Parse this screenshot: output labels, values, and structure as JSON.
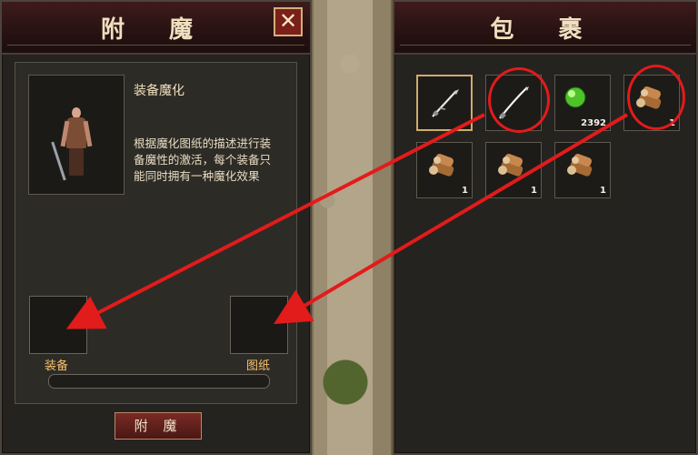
{
  "left_panel": {
    "title": "附 魔",
    "close_label": "✕",
    "description_title": "装备魔化",
    "description_text": "根据魔化图纸的描述进行装备魔性的激活，每个装备只能同时拥有一种魔化效果",
    "equipment_label": "装备",
    "blueprint_label": "图纸",
    "enchant_button": "附 魔",
    "progress": 0
  },
  "right_panel": {
    "title": "包 裹",
    "items": [
      {
        "name": "sword-1",
        "icon": "sword-icon",
        "quantity": ""
      },
      {
        "name": "sword-2",
        "icon": "sword-icon",
        "quantity": ""
      },
      {
        "name": "green-orb",
        "icon": "orb-icon",
        "quantity": "2392"
      },
      {
        "name": "wood-1",
        "icon": "wood-icon",
        "quantity": "1"
      },
      {
        "name": "wood-2",
        "icon": "wood-icon",
        "quantity": "1"
      },
      {
        "name": "wood-3",
        "icon": "wood-icon",
        "quantity": "1"
      },
      {
        "name": "wood-4",
        "icon": "wood-icon",
        "quantity": "1"
      }
    ]
  },
  "colors": {
    "accent": "#e21b1b",
    "gold": "#f5c16c"
  }
}
